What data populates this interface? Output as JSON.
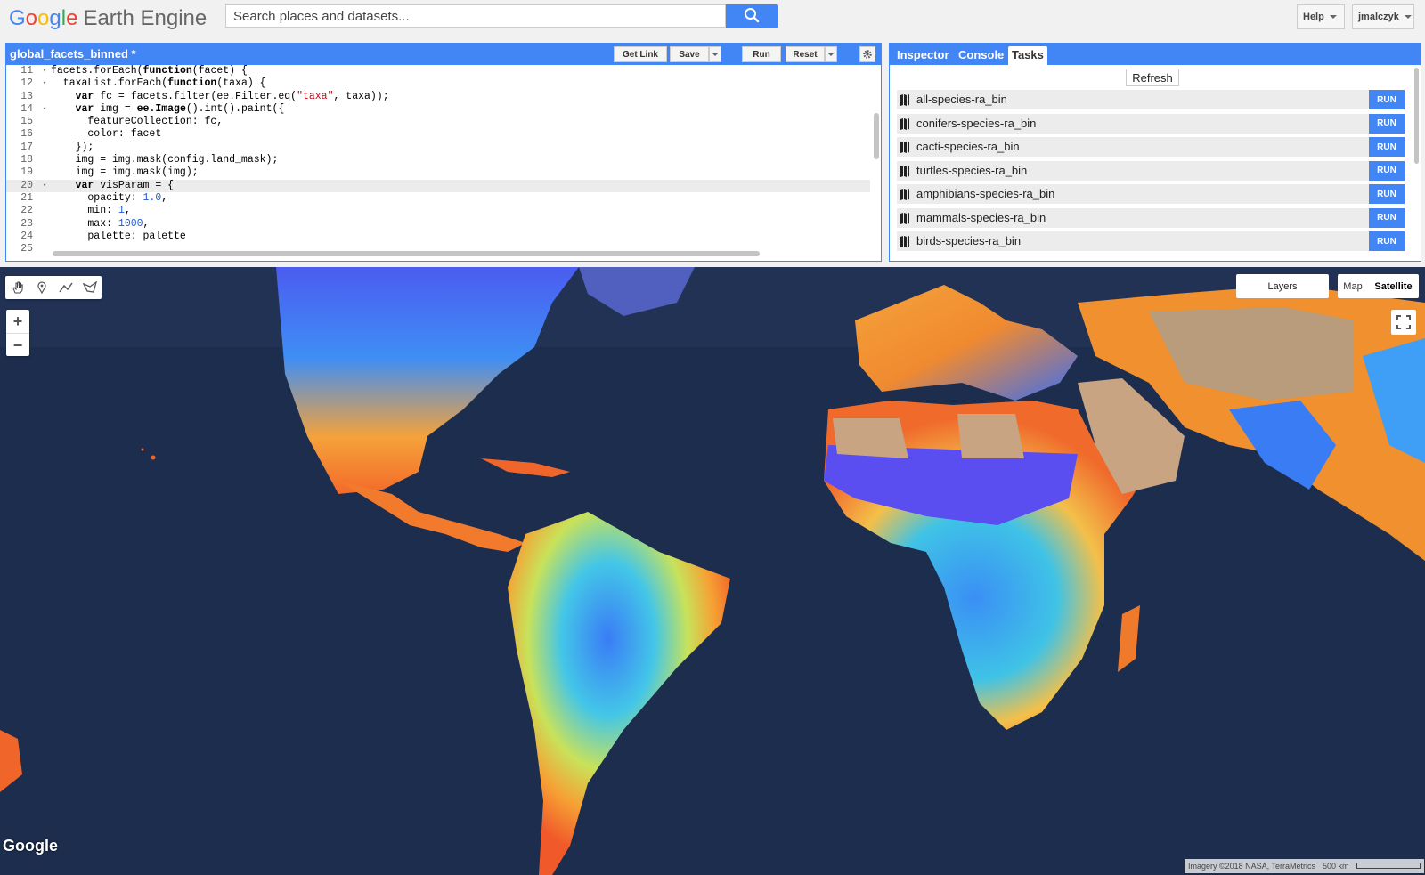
{
  "header": {
    "logo_google": "Google",
    "logo_product": "Earth Engine",
    "search_placeholder": "Search places and datasets...",
    "help_label": "Help",
    "user_label": "jmalczyk"
  },
  "code_editor": {
    "script_title": "global_facets_binned *",
    "buttons": {
      "get_link": "Get Link",
      "save": "Save",
      "run": "Run",
      "reset": "Reset"
    },
    "lines": [
      {
        "num": "11",
        "fold": true,
        "tokens": [
          [
            "",
            "facets.forEach("
          ],
          [
            "b",
            "function"
          ],
          [
            "",
            "(facet) {"
          ]
        ]
      },
      {
        "num": "12",
        "fold": true,
        "tokens": [
          [
            "",
            "  taxaList.forEach("
          ],
          [
            "b",
            "function"
          ],
          [
            "",
            "(taxa) {"
          ]
        ]
      },
      {
        "num": "13",
        "fold": false,
        "tokens": [
          [
            "",
            "    "
          ],
          [
            "b",
            "var"
          ],
          [
            "",
            " fc = facets.filter(ee.Filter.eq("
          ],
          [
            "st",
            "\"taxa\""
          ],
          [
            "",
            ", taxa));"
          ]
        ]
      },
      {
        "num": "14",
        "fold": true,
        "tokens": [
          [
            "",
            "    "
          ],
          [
            "b",
            "var"
          ],
          [
            "",
            " img = "
          ],
          [
            "b",
            "ee.Image"
          ],
          [
            "",
            "().int().paint({"
          ]
        ]
      },
      {
        "num": "15",
        "fold": false,
        "tokens": [
          [
            "",
            "      featureCollection: fc,"
          ]
        ]
      },
      {
        "num": "16",
        "fold": false,
        "tokens": [
          [
            "",
            "      color: facet"
          ]
        ]
      },
      {
        "num": "17",
        "fold": false,
        "tokens": [
          [
            "",
            "    });"
          ]
        ]
      },
      {
        "num": "18",
        "fold": false,
        "tokens": [
          [
            "",
            "    img = img.mask(config.land_mask);"
          ]
        ]
      },
      {
        "num": "19",
        "fold": false,
        "tokens": [
          [
            "",
            "    img = img.mask(img);"
          ]
        ]
      },
      {
        "num": "20",
        "fold": true,
        "highlight": true,
        "tokens": [
          [
            "",
            "    "
          ],
          [
            "b",
            "var"
          ],
          [
            "",
            " visParam = {"
          ]
        ]
      },
      {
        "num": "21",
        "fold": false,
        "tokens": [
          [
            "",
            "      opacity: "
          ],
          [
            "nm",
            "1.0"
          ],
          [
            "",
            ","
          ]
        ]
      },
      {
        "num": "22",
        "fold": false,
        "tokens": [
          [
            "",
            "      min: "
          ],
          [
            "nm",
            "1"
          ],
          [
            "",
            ","
          ]
        ]
      },
      {
        "num": "23",
        "fold": false,
        "tokens": [
          [
            "",
            "      max: "
          ],
          [
            "nm",
            "1000"
          ],
          [
            "",
            ","
          ]
        ]
      },
      {
        "num": "24",
        "fold": false,
        "tokens": [
          [
            "",
            "      palette: palette"
          ]
        ]
      },
      {
        "num": "25",
        "fold": false,
        "tokens": [
          [
            "",
            ""
          ]
        ]
      }
    ]
  },
  "right_panel": {
    "tabs": [
      {
        "label": "Inspector",
        "active": false
      },
      {
        "label": "Console",
        "active": false
      },
      {
        "label": "Tasks",
        "active": true
      }
    ],
    "refresh_label": "Refresh",
    "run_label": "RUN",
    "tasks": [
      "all-species-ra_bin",
      "conifers-species-ra_bin",
      "cacti-species-ra_bin",
      "turtles-species-ra_bin",
      "amphibians-species-ra_bin",
      "mammals-species-ra_bin",
      "birds-species-ra_bin"
    ]
  },
  "map": {
    "layers_label": "Layers",
    "map_type_options": [
      {
        "label": "Map",
        "active": false
      },
      {
        "label": "Satellite",
        "active": true
      }
    ],
    "google_watermark": "Google",
    "attribution": "Imagery ©2018 NASA, TerraMetrics",
    "scale_label": "500 km"
  },
  "colors": {
    "accent": "#4285f4",
    "ocean": "#1c2d4e"
  }
}
